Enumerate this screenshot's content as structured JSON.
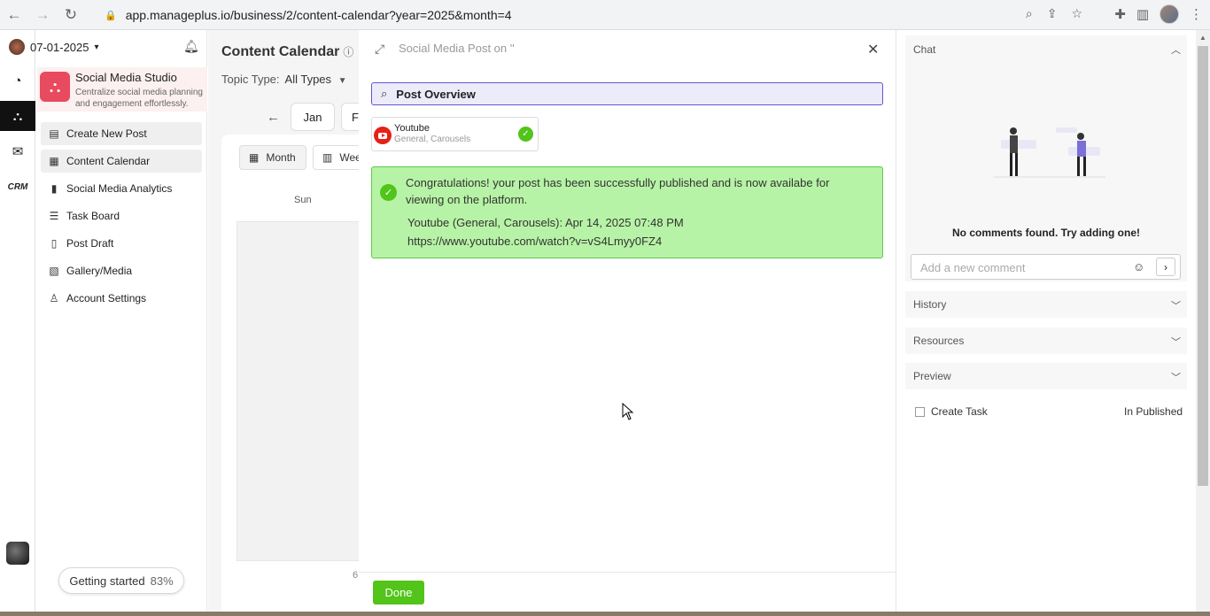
{
  "browser": {
    "url": "app.manageplus.io/business/2/content-calendar?year=2025&month=4"
  },
  "sidebar": {
    "date": "07-01-2025",
    "studio_title": "Social Media Studio",
    "studio_desc": "Centralize social media planning and engagement effortlessly.",
    "items": [
      {
        "label": "Create New Post",
        "icon": "create-post-icon"
      },
      {
        "label": "Content Calendar",
        "icon": "calendar-icon"
      },
      {
        "label": "Social Media Analytics",
        "icon": "analytics-icon"
      },
      {
        "label": "Task Board",
        "icon": "task-board-icon"
      },
      {
        "label": "Post Draft",
        "icon": "draft-icon"
      },
      {
        "label": "Gallery/Media",
        "icon": "gallery-icon"
      },
      {
        "label": "Account Settings",
        "icon": "user-icon"
      }
    ],
    "getting_started_label": "Getting started",
    "getting_started_pct": "83%"
  },
  "rail": {
    "crm_label": "CRM"
  },
  "calendar": {
    "title": "Content Calendar",
    "topic_label": "Topic Type:",
    "topic_value": "All Types",
    "month_jan": "Jan",
    "month_next": "F",
    "view_month": "Month",
    "view_week": "Wee",
    "day_sun": "Sun",
    "cell_number": "6"
  },
  "modal": {
    "title": "Social Media Post on ''",
    "overview_label": "Post Overview",
    "platform_name": "Youtube",
    "platform_sub": "General, Carousels",
    "success_message": "Congratulations! your post has been successfully published and is now availabe for viewing on the platform.",
    "success_detail": "Youtube (General, Carousels): Apr 14, 2025 07:48 PM",
    "success_url": "https://www.youtube.com/watch?v=vS4Lmyy0FZ4",
    "done_label": "Done"
  },
  "right_panel": {
    "chat_label": "Chat",
    "empty_text": "No comments found. Try adding one!",
    "comment_placeholder": "Add a new comment",
    "history_label": "History",
    "resources_label": "Resources",
    "preview_label": "Preview",
    "create_task_label": "Create Task",
    "status_label": "In Published"
  },
  "colors": {
    "accent_purple": "#6655cc",
    "success_green": "#52c41a",
    "success_bg": "#b7f3a6",
    "brand_red": "#e84b5f"
  }
}
